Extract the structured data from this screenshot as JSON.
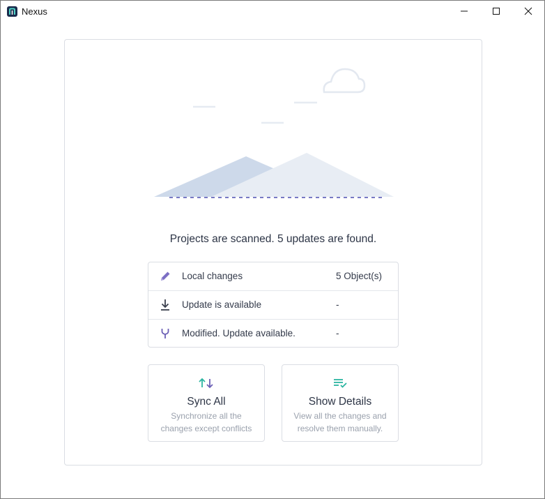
{
  "window": {
    "title": "Nexus",
    "controls": [
      "minimize-icon",
      "maximize-icon",
      "close-icon"
    ]
  },
  "status": {
    "message": "Projects are scanned. 5 updates are found."
  },
  "summary": {
    "rows": [
      {
        "icon": "pencil-icon",
        "label": "Local changes",
        "value": "5 Object(s)"
      },
      {
        "icon": "download-icon",
        "label": "Update is available",
        "value": "-"
      },
      {
        "icon": "merge-icon",
        "label": "Modified. Update available.",
        "value": "-"
      }
    ]
  },
  "actions": {
    "sync_all": {
      "icon": "sync-arrows-icon",
      "title": "Sync All",
      "description": "Synchronize all the changes except conflicts"
    },
    "show_details": {
      "icon": "list-check-icon",
      "title": "Show Details",
      "description": "View all the changes and resolve them manually."
    }
  },
  "colors": {
    "accent_teal": "#2bb5a0",
    "accent_purple": "#6b5fb5",
    "text_primary": "#2d3546",
    "text_muted": "#9aa1ad",
    "border": "#dadde3",
    "illustration_dark": "#cdd9ea",
    "illustration_light": "#e8edf4"
  }
}
